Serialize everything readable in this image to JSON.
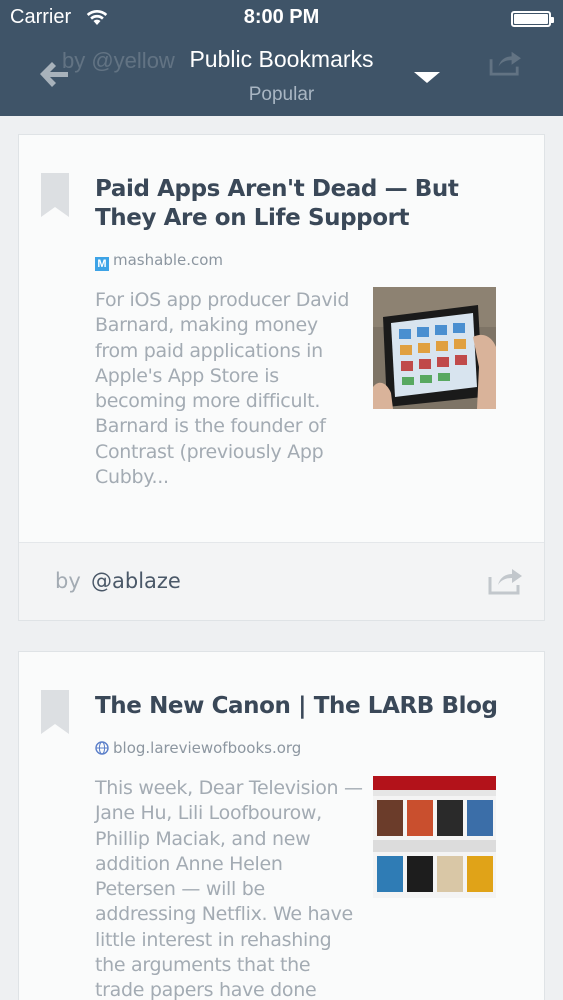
{
  "status_bar": {
    "carrier": "Carrier",
    "time": "8:00 PM"
  },
  "nav": {
    "title": "Public Bookmarks",
    "subtitle": "Popular",
    "ghost_text": "by @yellow",
    "back_icon": "back-arrow-icon",
    "dropdown_icon": "caret-down-icon",
    "share_icon": "share-icon"
  },
  "colors": {
    "header_bg": "#3f5468",
    "background": "#eef0f2",
    "card_bg": "#fafbfb",
    "title_text": "#3a4858",
    "excerpt_text": "#a3abb3"
  },
  "bookmarks": [
    {
      "title": "Paid Apps Aren't Dead — But They Are on Life Support",
      "source": "mashable.com",
      "source_icon": "mashable-m-icon",
      "excerpt": "For iOS app producer David Barnard, making money from paid applications in Apple's App Store is becoming more difficult. Barnard is the founder of Contrast (previously App Cubby...",
      "thumbnail": "ipad-in-hands-image",
      "by_label": "by",
      "user": "@ablaze"
    },
    {
      "title": "The New Canon | The LARB Blog",
      "source": "blog.lareviewofbooks.org",
      "source_icon": "globe-icon",
      "excerpt": "This week, Dear Television — Jane Hu, Lili Loofbourow, Phillip Maciak, and new addition Anne Helen Petersen — will be addressing Netflix. We have little interest in rehashing the arguments that the trade papers have done",
      "thumbnail": "netflix-grid-image"
    }
  ]
}
